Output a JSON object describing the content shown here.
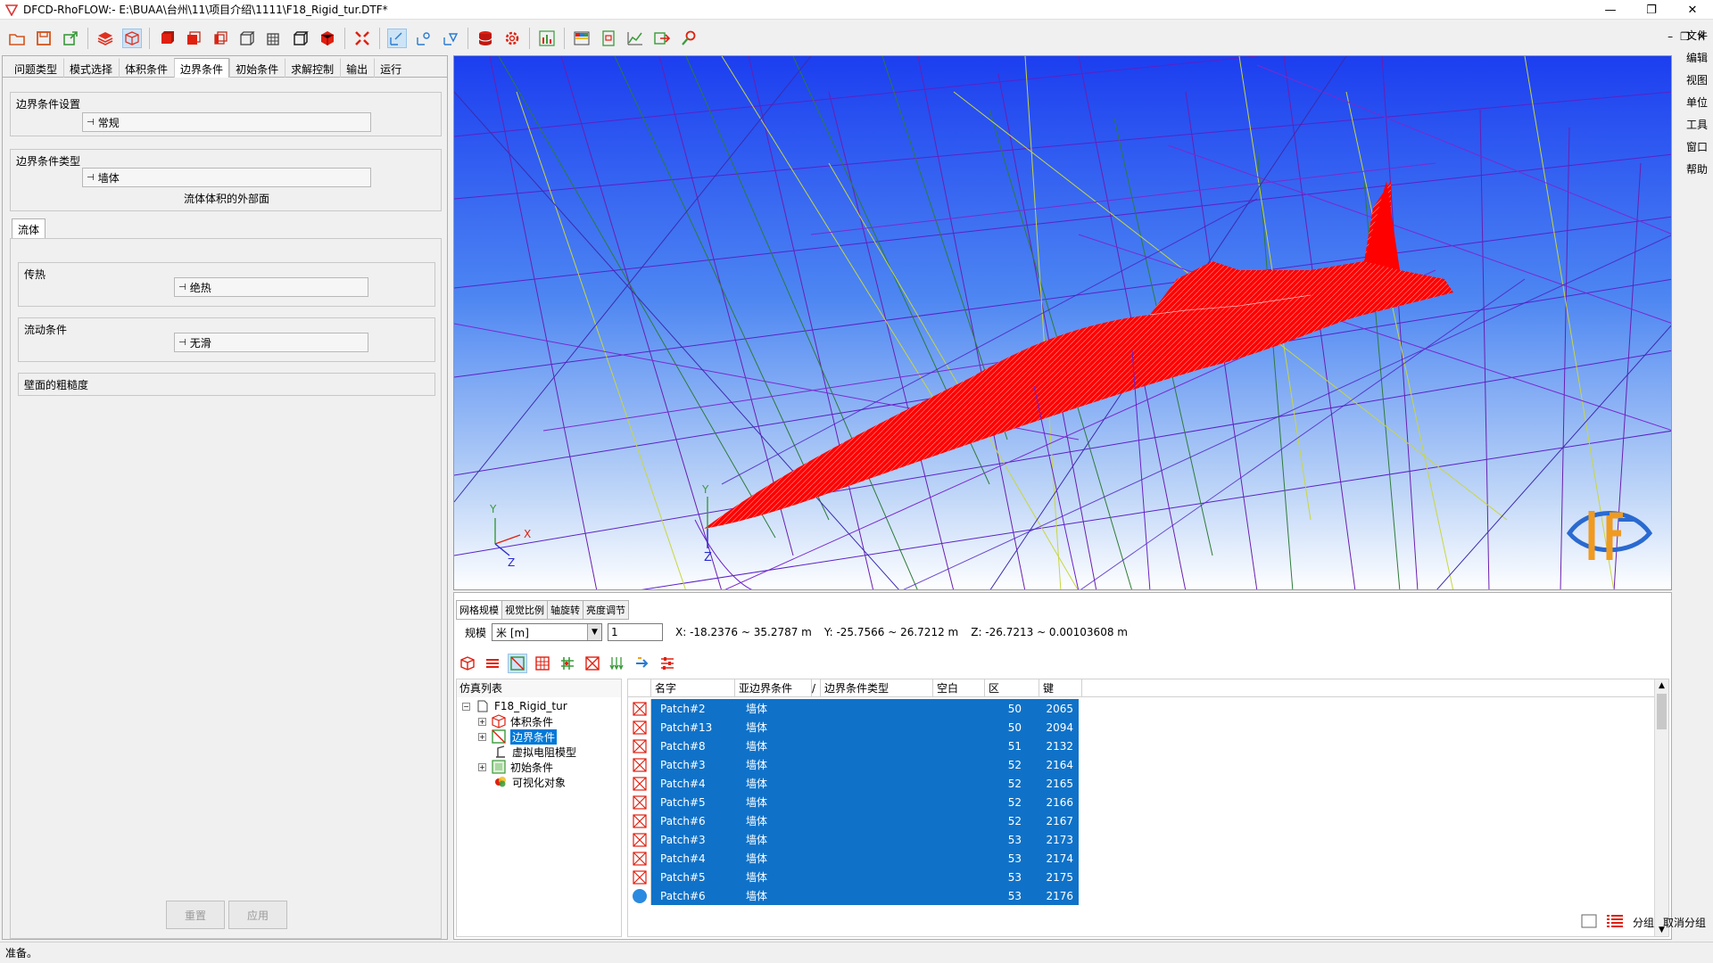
{
  "window": {
    "title": "DFCD-RhoFLOW:- E:\\BUAA\\台州\\11\\项目介绍\\1111\\F18_Rigid_tur.DTF*",
    "minimize": "—",
    "restore": "❐",
    "close": "✕"
  },
  "mdi": {
    "minimize": "–",
    "restore": "❐",
    "close": "✕"
  },
  "menu": [
    "文件",
    "编辑",
    "视图",
    "单位",
    "工具",
    "窗口",
    "帮助"
  ],
  "left_tabs": [
    "问题类型",
    "模式选择",
    "体积条件",
    "边界条件",
    "初始条件",
    "求解控制",
    "输出",
    "运行"
  ],
  "active_left_tab": "边界条件",
  "bc_settings": {
    "label": "边界条件设置",
    "value": "常规"
  },
  "bc_type": {
    "label": "边界条件类型",
    "value": "墙体",
    "note": "流体体积的外部面"
  },
  "sub_tab": "流体",
  "heat": {
    "label": "传热",
    "value": "绝热"
  },
  "flow_cond": {
    "label": "流动条件",
    "value": "无滑"
  },
  "roughness": {
    "label": "壁面的粗糙度"
  },
  "buttons": {
    "reset": "重置",
    "apply": "应用"
  },
  "viewport": {
    "axis_y": "Y",
    "axis_x": "X",
    "axis_z": "Z",
    "model_y": "Y",
    "model_z": "Z",
    "colors": {
      "sky_top": "#1a3df0",
      "sky_bottom": "#ffffff",
      "model": "#ff0000"
    }
  },
  "bottom_tabs": [
    "网格规模",
    "视觉比例",
    "轴旋转",
    "亮度调节"
  ],
  "scale": {
    "label": "规模",
    "unit": "米 [m]",
    "factor": "1",
    "x_range": "X: -18.2376 ~ 35.2787 m",
    "y_range": "Y: -25.7566 ~ 26.7212 m",
    "z_range": "Z: -26.7213 ~ 0.00103608 m"
  },
  "tree": {
    "header": "仿真列表",
    "root": "F18_Rigid_tur",
    "items": [
      "体积条件",
      "边界条件",
      "虚拟电阻模型",
      "初始条件",
      "可视化对象"
    ]
  },
  "table": {
    "columns": [
      "名字",
      "亚边界条件",
      "/",
      "边界条件类型",
      "空白",
      "区",
      "键"
    ],
    "rows": [
      {
        "name": "Patch#2",
        "sub": "墙体",
        "zone": "50",
        "key": "2065"
      },
      {
        "name": "Patch#13",
        "sub": "墙体",
        "zone": "50",
        "key": "2094"
      },
      {
        "name": "Patch#8",
        "sub": "墙体",
        "zone": "51",
        "key": "2132"
      },
      {
        "name": "Patch#3",
        "sub": "墙体",
        "zone": "52",
        "key": "2164"
      },
      {
        "name": "Patch#4",
        "sub": "墙体",
        "zone": "52",
        "key": "2165"
      },
      {
        "name": "Patch#5",
        "sub": "墙体",
        "zone": "52",
        "key": "2166"
      },
      {
        "name": "Patch#6",
        "sub": "墙体",
        "zone": "52",
        "key": "2167"
      },
      {
        "name": "Patch#3",
        "sub": "墙体",
        "zone": "53",
        "key": "2173"
      },
      {
        "name": "Patch#4",
        "sub": "墙体",
        "zone": "53",
        "key": "2174"
      },
      {
        "name": "Patch#5",
        "sub": "墙体",
        "zone": "53",
        "key": "2175"
      },
      {
        "name": "Patch#6",
        "sub": "墙体",
        "zone": "53",
        "key": "2176"
      }
    ]
  },
  "group_buttons": {
    "group": "分组",
    "ungroup": "取消分组"
  },
  "status": "准备。",
  "accent": "#0f72c8"
}
